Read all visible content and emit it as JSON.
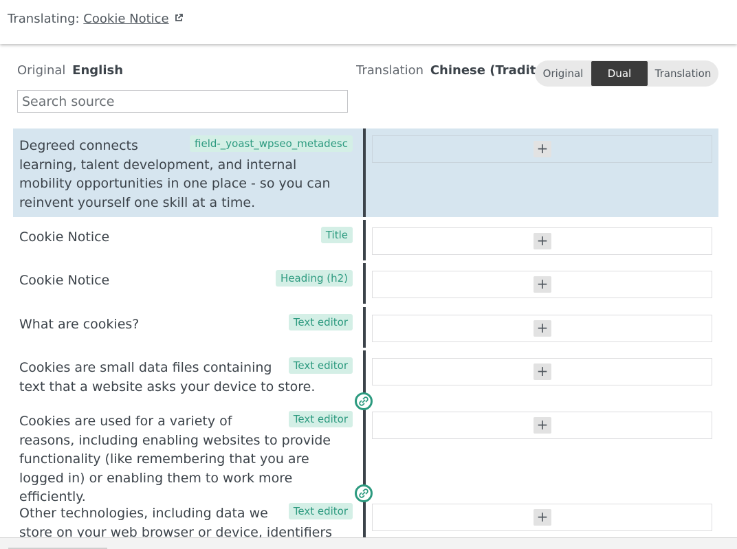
{
  "header": {
    "prefix": "Translating:",
    "page_link": "Cookie Notice",
    "external_icon": "external-link-icon"
  },
  "languages": {
    "original_label": "Original",
    "original_lang": "English",
    "translation_label": "Translation",
    "translation_lang": "Chinese (Traditional)"
  },
  "view_toggle": {
    "options": [
      "Original",
      "Dual",
      "Translation"
    ],
    "active": "Dual"
  },
  "search": {
    "placeholder": "Search source"
  },
  "rows": [
    {
      "text": "Degreed connects learning, talent development, and internal mobility opportunities in one place - so you can reinvent yourself one skill at a time.",
      "badge": "field-_yoast_wpseo_metadesc",
      "highlighted": true
    },
    {
      "text": "Cookie Notice",
      "badge": "Title"
    },
    {
      "text": "Cookie Notice",
      "badge": "Heading (h2)"
    },
    {
      "text": "What are cookies?",
      "badge": "Text editor"
    },
    {
      "text": "Cookies are small data files containing text that a website asks your device to store.",
      "badge": "Text editor"
    },
    {
      "text": "Cookies are used for a variety of reasons, including enabling websites to provide functionality (like remembering that you are logged in) or enabling them to work more efficiently.",
      "badge": "Text editor"
    },
    {
      "text": "Other technologies, including data we store on your web browser or device, identifiers associated",
      "badge": "Text editor"
    }
  ],
  "add_button_label": "+",
  "icons": {
    "link": "link-icon"
  },
  "colors": {
    "highlight": "#d6e5ef",
    "badge_bg": "#d4efe6",
    "badge_text": "#2c9a7f",
    "toggle_active": "#3b3b3b"
  }
}
